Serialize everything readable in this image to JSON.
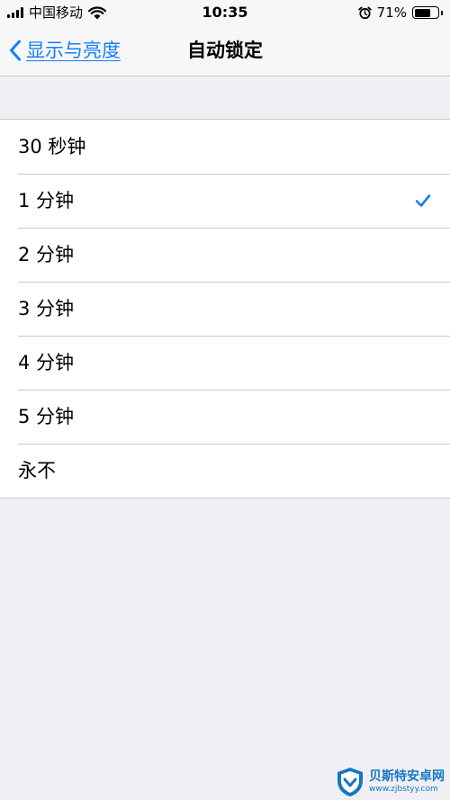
{
  "status_bar": {
    "carrier": "中国移动",
    "time": "10:35",
    "battery_percent_text": "71%",
    "battery_level": 0.71,
    "icons": [
      "signal-icon",
      "wifi-icon",
      "alarm-icon",
      "battery-icon"
    ]
  },
  "nav": {
    "back_label": "显示与亮度",
    "title": "自动锁定"
  },
  "options": [
    {
      "label": "30 秒钟",
      "selected": false
    },
    {
      "label": "1 分钟",
      "selected": true
    },
    {
      "label": "2 分钟",
      "selected": false
    },
    {
      "label": "3 分钟",
      "selected": false
    },
    {
      "label": "4 分钟",
      "selected": false
    },
    {
      "label": "5 分钟",
      "selected": false
    },
    {
      "label": "永不",
      "selected": false
    }
  ],
  "watermark": {
    "name": "贝斯特安卓网",
    "url": "www.zjbstyy.com"
  },
  "colors": {
    "accent": "#157efb",
    "background": "#efeff4",
    "bar": "#f7f7f7",
    "separator": "#c8c7cc"
  }
}
